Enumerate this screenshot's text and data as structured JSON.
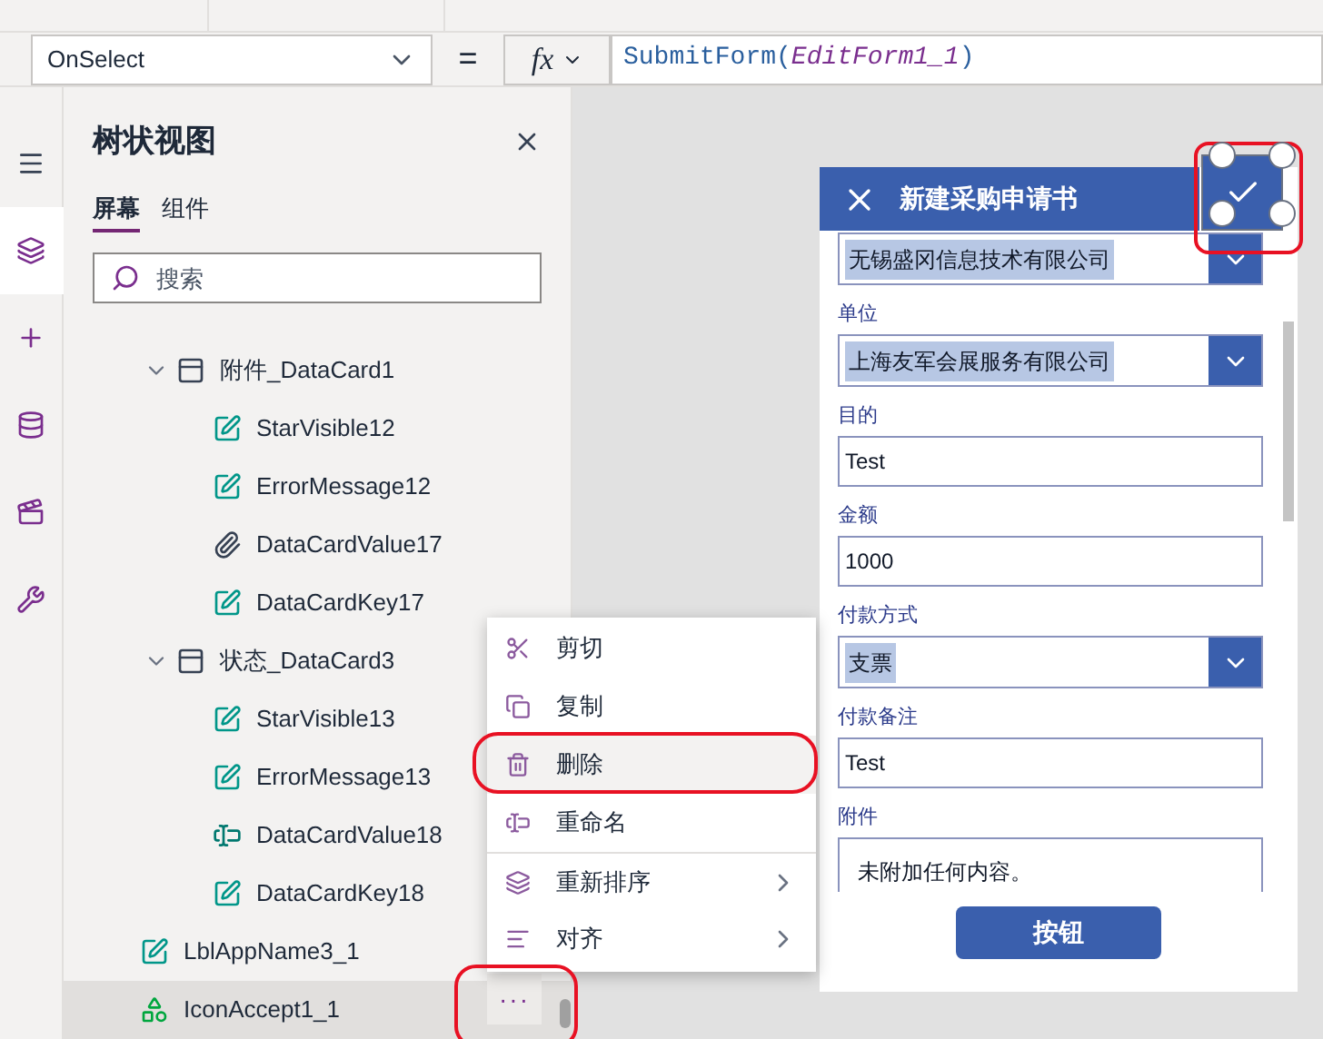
{
  "property_dropdown": {
    "value": "OnSelect"
  },
  "equals": "=",
  "formula": {
    "fx": "fx",
    "parts": [
      {
        "kind": "function",
        "text": "SubmitForm("
      },
      {
        "kind": "argument",
        "text": "EditForm1_1"
      },
      {
        "kind": "function",
        "text": ")"
      }
    ]
  },
  "rail": [
    {
      "kind": "menu",
      "selected": false
    },
    {
      "kind": "layers",
      "selected": true
    },
    {
      "kind": "plus",
      "selected": false
    },
    {
      "kind": "database",
      "selected": false
    },
    {
      "kind": "media",
      "selected": false
    },
    {
      "kind": "tools",
      "selected": false
    }
  ],
  "tree_panel": {
    "title": "树状视图",
    "tabs": [
      {
        "label": "屏幕",
        "selected": true
      },
      {
        "label": "组件",
        "selected": false
      }
    ],
    "search": {
      "placeholder": "搜索"
    },
    "items": [
      {
        "name": "附件_DataCard1",
        "kind": "card",
        "expanded": true,
        "selected": false,
        "children": [
          {
            "name": "StarVisible12",
            "kind": "edit",
            "selected": false
          },
          {
            "name": "ErrorMessage12",
            "kind": "edit",
            "selected": false
          },
          {
            "name": "DataCardValue17",
            "kind": "attachment",
            "selected": false
          },
          {
            "name": "DataCardKey17",
            "kind": "edit",
            "selected": false
          }
        ]
      },
      {
        "name": "状态_DataCard3",
        "kind": "card",
        "expanded": true,
        "selected": false,
        "children": [
          {
            "name": "StarVisible13",
            "kind": "edit",
            "selected": false
          },
          {
            "name": "ErrorMessage13",
            "kind": "edit",
            "selected": false
          },
          {
            "name": "DataCardValue18",
            "kind": "textinput",
            "selected": false
          },
          {
            "name": "DataCardKey18",
            "kind": "edit",
            "selected": false
          }
        ]
      },
      {
        "name": "LblAppName3_1",
        "kind": "edit",
        "selected": false
      },
      {
        "name": "IconAccept1_1",
        "kind": "icons",
        "selected": true,
        "more": "···"
      }
    ]
  },
  "context_menu": [
    {
      "label": "剪切",
      "kind": "cut",
      "selected": false,
      "submenu": false,
      "separator_above": false
    },
    {
      "label": "复制",
      "kind": "copy",
      "selected": false,
      "submenu": false,
      "separator_above": false
    },
    {
      "label": "删除",
      "kind": "delete",
      "selected": true,
      "submenu": false,
      "separator_above": false
    },
    {
      "label": "重命名",
      "kind": "rename",
      "selected": false,
      "submenu": false,
      "separator_above": false
    },
    {
      "label": "重新排序",
      "kind": "reorder",
      "selected": false,
      "submenu": true,
      "separator_above": true
    },
    {
      "label": "对齐",
      "kind": "align",
      "selected": false,
      "submenu": true,
      "separator_above": false
    }
  ],
  "form": {
    "title": "新建采购申请书",
    "check_selected": true,
    "fields": [
      {
        "kind": "dropdown",
        "value": "无锡盛冈信息技术有限公司"
      },
      {
        "kind": "dropdown",
        "label": "单位",
        "value": "上海友军会展服务有限公司"
      },
      {
        "kind": "text",
        "label": "目的",
        "value": "Test"
      },
      {
        "kind": "text",
        "label": "金额",
        "value": "1000"
      },
      {
        "kind": "dropdown",
        "label": "付款方式",
        "value": "支票"
      },
      {
        "kind": "text",
        "label": "付款备注",
        "value": "Test"
      },
      {
        "kind": "attachment",
        "label": "附件",
        "value": "未附加任何内容。"
      }
    ],
    "button": "按钮"
  }
}
